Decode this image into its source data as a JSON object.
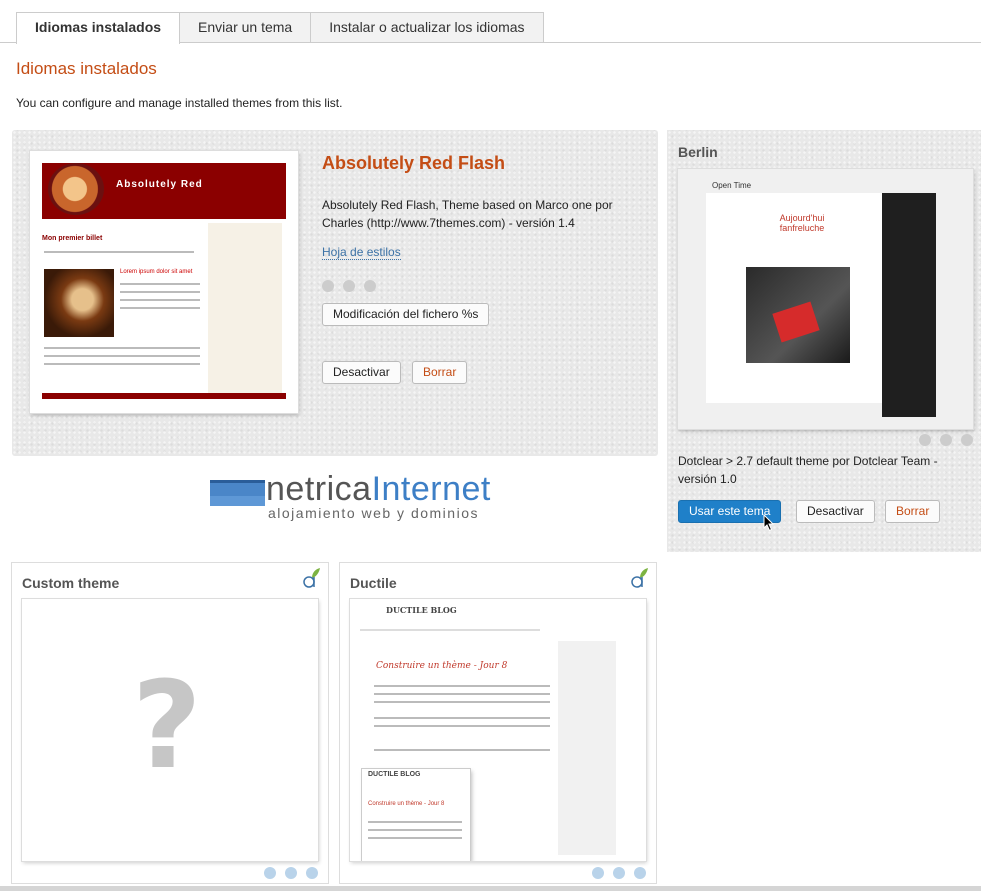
{
  "tabs": [
    {
      "label": "Idiomas instalados",
      "active": true
    },
    {
      "label": "Enviar un tema",
      "active": false
    },
    {
      "label": "Instalar o actualizar los idiomas",
      "active": false
    }
  ],
  "page": {
    "title": "Idiomas instalados",
    "intro": "You can configure and manage installed themes from this list."
  },
  "current_theme": {
    "name": "Absolutely Red Flash",
    "description": "Absolutely Red Flash, Theme based on Marco one por Charles (http://www.7themes.com) - versión 1.4",
    "stylesheet_link": "Hoja de estilos",
    "edit_button": "Modificación del fichero %s",
    "deactivate_button": "Desactivar",
    "delete_button": "Borrar",
    "thumbnail": {
      "brand": "Absolutely Red",
      "post_title": "Mon premier billet",
      "subtitle": "Lorem ipsum dolor sit amet"
    }
  },
  "logo": {
    "word1": "netrica",
    "word2": "Internet",
    "tagline": "alojamiento web y dominios"
  },
  "berlin_theme": {
    "name": "Berlin",
    "description": "Dotclear > 2.7 default theme por Dotclear Team - versión 1.0",
    "use_button": "Usar este tema",
    "deactivate_button": "Desactivar",
    "delete_button": "Borrar",
    "thumbnail": {
      "brand": "Open Time",
      "post_title": "Aujourd'hui fanfreluche"
    }
  },
  "custom_theme": {
    "name": "Custom theme",
    "placeholder_glyph": "?"
  },
  "ductile_theme": {
    "name": "Ductile",
    "thumbnail": {
      "brand": "DUCTILE BLOG",
      "post_title": "Construire un thème - Jour 8"
    }
  },
  "colors": {
    "accent": "#c44d15",
    "link": "#3c72a6",
    "primary_button": "#1f80c9",
    "dot_inactive": "#cccccc",
    "dot_blue": "#b9d3ea"
  },
  "icons": {
    "dotclear": "dotclear-leaf-icon",
    "pager": "pager-dot-icon"
  }
}
